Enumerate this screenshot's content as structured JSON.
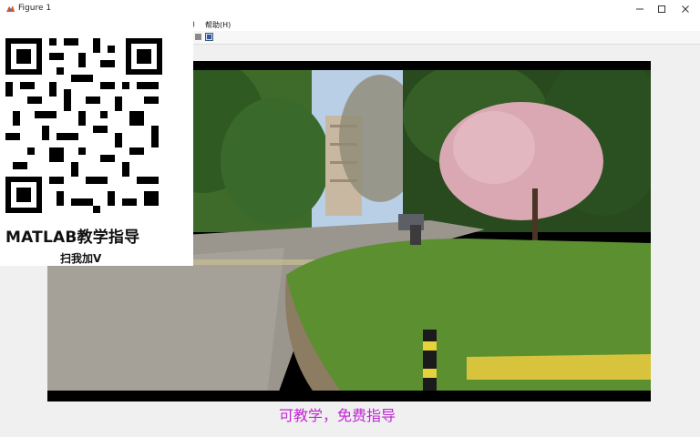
{
  "window": {
    "title": "Figure 1"
  },
  "menu": {
    "items": [
      "/)",
      "帮助(H)"
    ]
  },
  "overlay": {
    "brand": "MATLAB教学指导",
    "subtitle": "扫我加V",
    "caption": "可教学，免费指导"
  },
  "colors": {
    "caption": "#c026d3",
    "titlebar": "#ffffff",
    "figure_background": "#f0f0f0"
  },
  "icons": [
    "matlab-figure-icon",
    "minimize-icon",
    "maximize-icon",
    "close-icon",
    "toolbar-tool-icon",
    "toolbar-image-icon",
    "qr-code-icon"
  ]
}
